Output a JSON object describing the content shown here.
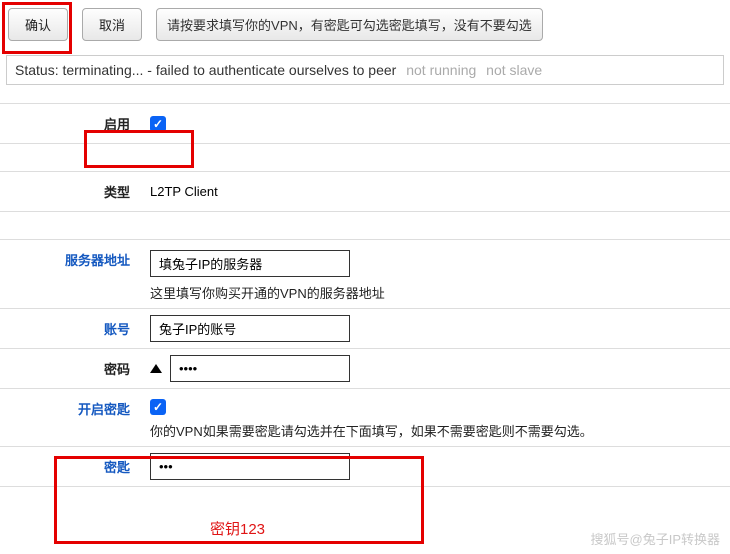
{
  "toolbar": {
    "confirm": "确认",
    "cancel": "取消",
    "hint": "请按要求填写你的VPN，有密匙可勾选密匙填写，没有不要勾选"
  },
  "status": {
    "main": "Status: terminating... - failed to authenticate ourselves to peer",
    "tag1": "not running",
    "tag2": "not slave"
  },
  "rows": {
    "enable_label": "启用",
    "type_label": "类型",
    "type_value": "L2TP Client",
    "server_label": "服务器地址",
    "server_placeholder": "填兔子IP的服务器",
    "server_help": "这里填写你购买开通的VPN的服务器地址",
    "account_label": "账号",
    "account_value": "兔子IP的账号",
    "password_label": "密码",
    "password_value": "••••",
    "enable_key_label": "开启密匙",
    "enable_key_help": "你的VPN如果需要密匙请勾选并在下面填写，如果不需要密匙则不需要勾选。",
    "key_label": "密匙",
    "key_value": "•••",
    "key_overlay": "密钥123"
  },
  "watermark": "搜狐号@兔子IP转换器"
}
